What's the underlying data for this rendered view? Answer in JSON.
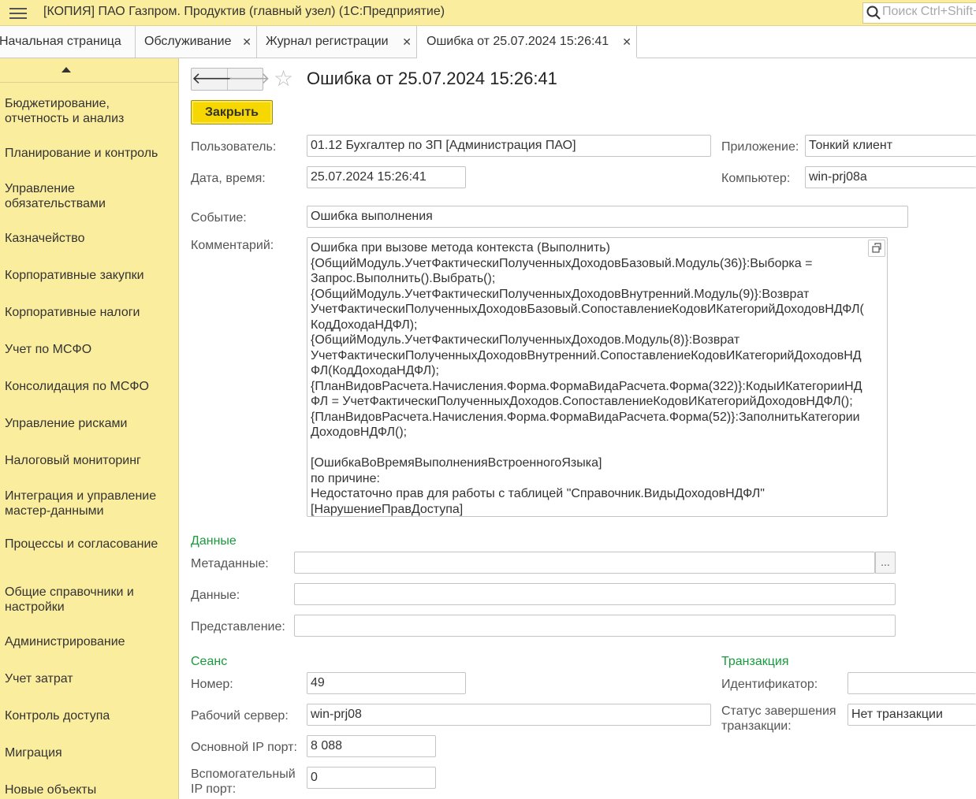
{
  "window": {
    "title": "[КОПИЯ] ПАО Газпром. Продуктив (главный узел)  (1С:Предприятие)",
    "search_placeholder": "Поиск Ctrl+Shift+F"
  },
  "tabs": [
    {
      "label": "Начальная страница",
      "closable": false
    },
    {
      "label": "Обслуживание",
      "closable": true
    },
    {
      "label": "Журнал регистрации",
      "closable": true
    },
    {
      "label": "Ошибка от 25.07.2024 15:26:41",
      "closable": true,
      "active": true
    }
  ],
  "tab_close_glyph": "✕",
  "sidebar": {
    "items": [
      {
        "label": "Бюджетирование, отчетность и анализ"
      },
      {
        "label": "Планирование и контроль"
      },
      {
        "label": "Управление обязательствами"
      },
      {
        "label": "Казначейство"
      },
      {
        "label": "Корпоративные закупки"
      },
      {
        "label": "Корпоративные налоги"
      },
      {
        "label": "Учет по МСФО"
      },
      {
        "label": "Консолидация по МСФО"
      },
      {
        "label": "Управление рисками"
      },
      {
        "label": "Налоговый мониторинг"
      },
      {
        "label": "Интеграция и управление мастер-данными"
      },
      {
        "label": "Процессы и согласование"
      },
      {
        "label": "Общие справочники и настройки"
      },
      {
        "label": "Администрирование"
      },
      {
        "label": "Учет затрат"
      },
      {
        "label": "Контроль доступа"
      },
      {
        "label": "Миграция"
      },
      {
        "label": "Новые объекты"
      }
    ]
  },
  "form": {
    "title": "Ошибка от 25.07.2024 15:26:41",
    "nav_back": "🡐",
    "nav_forward": "🡒",
    "close_button": "Закрыть",
    "user_label": "Пользователь:",
    "user_value": "01.12 Бухгалтер по ЗП [Администрация ПАО]",
    "app_label": "Приложение:",
    "app_value": "Тонкий клиент",
    "datetime_label": "Дата, время:",
    "datetime_value": "25.07.2024 15:26:41",
    "computer_label": "Компьютер:",
    "computer_value": "win-prj08a",
    "event_label": "Событие:",
    "event_value": "Ошибка выполнения",
    "comment_label": "Комментарий:",
    "comment_lines": [
      "Ошибка при вызове метода контекста (Выполнить)",
      "{ОбщийМодуль.УчетФактическиПолученныхДоходовБазовый.Модуль(36)}:Выборка =",
      "Запрос.Выполнить().Выбрать();",
      "{ОбщийМодуль.УчетФактическиПолученныхДоходовВнутренний.Модуль(9)}:Возврат",
      "УчетФактическиПолученныхДоходовБазовый.СопоставлениеКодовИКатегорийДоходовНДФЛ(",
      "КодДоходаНДФЛ);",
      "{ОбщийМодуль.УчетФактическиПолученныхДоходов.Модуль(8)}:Возврат",
      "УчетФактическиПолученныхДоходовВнутренний.СопоставлениеКодовИКатегорийДоходовНД",
      "ФЛ(КодДоходаНДФЛ);",
      "{ПланВидовРасчета.Начисления.Форма.ФормаВидаРасчета.Форма(322)}:КодыИКатегорииНД",
      "ФЛ = УчетФактическиПолученныхДоходов.СопоставлениеКодовИКатегорийДоходовНДФЛ();",
      "{ПланВидовРасчета.Начисления.Форма.ФормаВидаРасчета.Форма(52)}:ЗаполнитьКатегории",
      "ДоходовНДФЛ();",
      "",
      "[ОшибкаВоВремяВыполненияВстроенногоЯзыка]",
      "по причине:",
      "Недостаточно прав для работы с таблицей \"Справочник.ВидыДоходовНДФЛ\"",
      "[НарушениеПравДоступа]"
    ],
    "data_section": "Данные",
    "metadata_label": "Метаданные:",
    "metadata_value": "",
    "metadata_button": "...",
    "data_label": "Данные:",
    "data_value": "",
    "presentation_label": "Представление:",
    "presentation_value": "",
    "session_section": "Сеанс",
    "number_label": "Номер:",
    "number_value": "49",
    "server_label": "Рабочий сервер:",
    "server_value": "win-prj08",
    "main_port_label": "Основной IP порт:",
    "main_port_value": "8 088",
    "aux_port_label_1": "Вспомогательный",
    "aux_port_label_2": "IP порт:",
    "aux_port_value": "0",
    "transaction_section": "Транзакция",
    "tx_id_label": "Идентификатор:",
    "tx_id_value": "",
    "tx_status_label_1": "Статус завершения",
    "tx_status_label_2": "транзакции:",
    "tx_status_value": "Нет транзакции"
  },
  "colors": {
    "panel_yellow": "#fbed9e",
    "button_yellow": "#f6d700",
    "section_green": "#1a9a3e"
  }
}
